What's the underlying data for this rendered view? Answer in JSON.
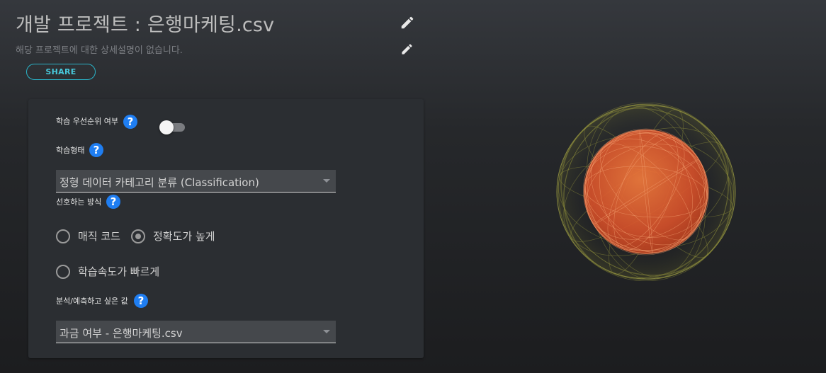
{
  "header": {
    "title": "개발 프로젝트 : 은행마케팅.csv",
    "description": "해당 프로젝트에 대한 상세설명이 없습니다.",
    "share_label": "SHARE"
  },
  "form": {
    "priority_label": "학습 우선순위 여부",
    "priority_enabled": false,
    "learning_type_label": "학습형태",
    "learning_type_value": "정형 데이터 카테고리 분류 (Classification)",
    "preferred_method_label": "선호하는 방식",
    "methods": [
      {
        "label": "매직 코드",
        "checked": false
      },
      {
        "label": "정확도가 높게",
        "checked": true
      },
      {
        "label": "학습속도가 빠르게",
        "checked": false
      }
    ],
    "target_label": "분석/예측하고 싶은 값",
    "target_value": "과금 여부 - 은행마케팅.csv",
    "help_glyph": "?"
  },
  "colors": {
    "accent_share": "#2ab3c7",
    "help_badge": "#1f7ef2",
    "sphere_inner": "#e0562a",
    "sphere_outer": "#8a8a3a"
  }
}
